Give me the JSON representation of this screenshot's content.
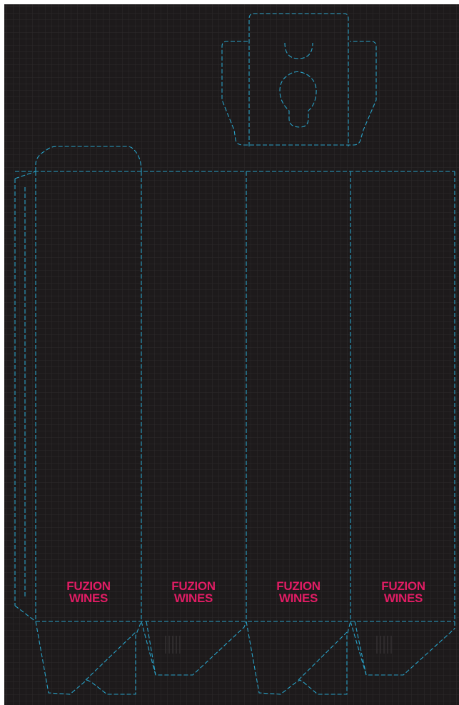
{
  "colors": {
    "page_background": "#ffffff",
    "board_background": "#1d1a1b",
    "grid_line": "#2d2a2b",
    "dieline": "#29a3c9",
    "brand_text": "#e11c64",
    "vent_marks": "#3a3738"
  },
  "brand": {
    "panels": [
      {
        "line1": "FUZION",
        "line2": "WINES"
      },
      {
        "line1": "FUZION",
        "line2": "WINES"
      },
      {
        "line1": "FUZION",
        "line2": "WINES"
      },
      {
        "line1": "FUZION",
        "line2": "WINES"
      }
    ]
  },
  "dieline": {
    "panel_count": 4,
    "has_handle_tab": true,
    "has_glue_flap": true,
    "bottom_style": "crash-lock"
  }
}
